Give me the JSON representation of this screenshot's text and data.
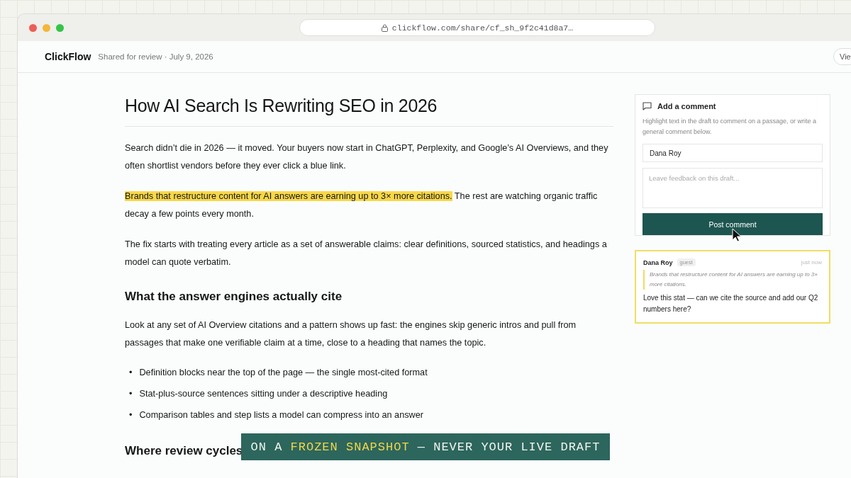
{
  "browser": {
    "url": "clickflow.com/share/cf_sh_9f2c41d8a7…"
  },
  "header": {
    "brand": "ClickFlow",
    "subtitle": "Shared for review · July 9, 2026",
    "button": "Vie"
  },
  "article": {
    "title": "How AI Search Is Rewriting SEO in 2026",
    "blocks": [
      {
        "kind": "paragraph",
        "segments": [
          {
            "text": "Search didn’t die in 2026 — it moved. Your buyers now start in ChatGPT, Perplexity, and Google’s AI Overviews, and they often shortlist vendors before they ever click a blue link.",
            "highlighted": false
          }
        ]
      },
      {
        "kind": "paragraph",
        "segments": [
          {
            "text": "Brands that restructure content for AI answers are earning up to 3× more citations.",
            "highlighted": true
          },
          {
            "text": " The rest are watching organic traffic decay a few points every month.",
            "highlighted": false
          }
        ]
      },
      {
        "kind": "paragraph",
        "segments": [
          {
            "text": "The fix starts with treating every article as a set of answerable claims: clear definitions, sourced statistics, and headings a model can quote verbatim.",
            "highlighted": false
          }
        ]
      },
      {
        "kind": "heading",
        "text": "What the answer engines actually cite"
      },
      {
        "kind": "paragraph",
        "segments": [
          {
            "text": "Look at any set of AI Overview citations and a pattern shows up fast: the engines skip generic intros and pull from passages that make one verifiable claim at a time, close to a heading that names the topic.",
            "highlighted": false
          }
        ]
      },
      {
        "kind": "list",
        "marker": "•",
        "items": [
          "Definition blocks near the top of the page — the single most-cited format",
          "Stat-plus-source sentences sitting under a descriptive heading",
          "Comparison tables and step lists a model can compress into an answer"
        ]
      },
      {
        "kind": "heading",
        "text": "Where review cycles"
      }
    ]
  },
  "comment_form": {
    "title": "Add a comment",
    "hint": "Highlight text in the draft to comment on a passage, or write a general comment below.",
    "name_value": "Dana Roy",
    "placeholder": "Leave feedback on this draft...",
    "button": "Post comment"
  },
  "comments": [
    {
      "author": "Dana Roy",
      "badge": "guest",
      "time": "just now",
      "quote": "Brands that restructure content for AI answers are earning up to 3× more citations.",
      "body": "Love this stat — can we cite the source and add our Q2 numbers here?",
      "selected": true
    }
  ],
  "caption": {
    "segments": [
      {
        "text": "ON A ",
        "highlighted": false
      },
      {
        "text": "FROZEN SNAPSHOT",
        "highlighted": true
      },
      {
        "text": " — NEVER YOUR LIVE DRAFT",
        "highlighted": false
      }
    ]
  }
}
